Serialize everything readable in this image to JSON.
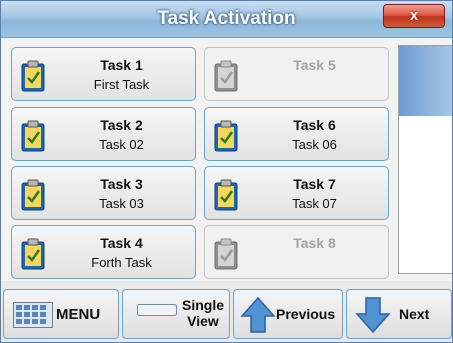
{
  "window": {
    "title": "Task Activation",
    "close_label": "x"
  },
  "tasks": [
    {
      "title": "Task 1",
      "subtitle": "First Task",
      "enabled": true
    },
    {
      "title": "Task 5",
      "subtitle": "",
      "enabled": false
    },
    {
      "title": "Task 2",
      "subtitle": "Task 02",
      "enabled": true
    },
    {
      "title": "Task 6",
      "subtitle": "Task 06",
      "enabled": true
    },
    {
      "title": "Task 3",
      "subtitle": "Task 03",
      "enabled": true
    },
    {
      "title": "Task 7",
      "subtitle": "Task 07",
      "enabled": true
    },
    {
      "title": "Task 4",
      "subtitle": "Forth Task",
      "enabled": true
    },
    {
      "title": "Task 8",
      "subtitle": "",
      "enabled": false
    }
  ],
  "toolbar": {
    "menu_label": "MENU",
    "single_view_line1": "Single",
    "single_view_line2": "View",
    "previous_label": "Previous",
    "next_label": "Next"
  },
  "icons": {
    "task": "clipboard-check-icon",
    "menu": "keypad-grid-icon",
    "single_view": "single-view-icon",
    "previous": "arrow-up-icon",
    "next": "arrow-down-icon"
  },
  "colors": {
    "accent": "#4f93d2",
    "title_bar": "#a3c6e3",
    "close": "#d9523b",
    "disabled_text": "#a3a3a3"
  }
}
